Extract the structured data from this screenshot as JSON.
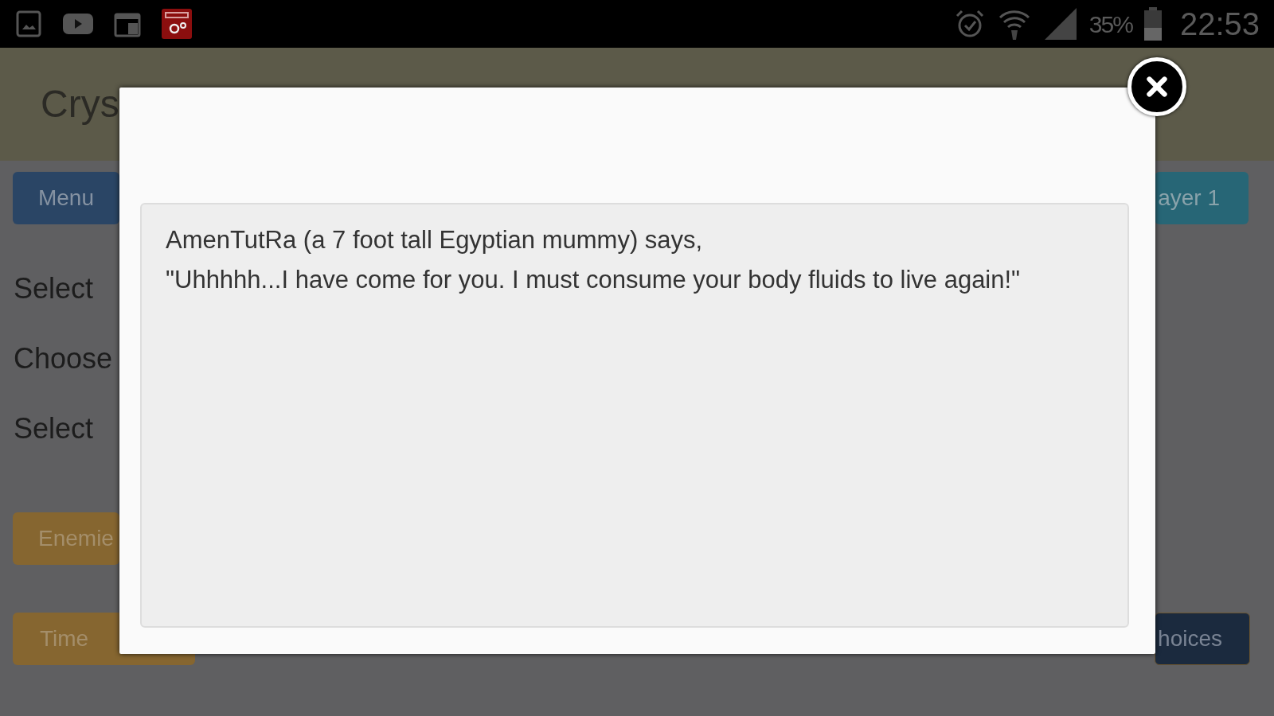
{
  "status_bar": {
    "battery": "35%",
    "time": "22:53"
  },
  "header": {
    "title": "Crys"
  },
  "top_buttons": [
    {
      "label": "Menu",
      "kind": "menu"
    },
    {
      "label": "ayer 1",
      "kind": "player"
    }
  ],
  "labels": [
    "Select",
    "Choose",
    "Select"
  ],
  "bottom_buttons": [
    {
      "label": "Enemie",
      "kind": "orange"
    },
    {
      "label": "Time",
      "kind": "orange"
    },
    {
      "label": "hoices",
      "kind": "navy"
    }
  ],
  "dialog": {
    "message_lines": [
      "AmenTutRa (a 7 foot tall Egyptian mummy)  says,",
      "\"Uhhhhh...I have come for you. I must consume your body fluids to live again!\""
    ]
  }
}
